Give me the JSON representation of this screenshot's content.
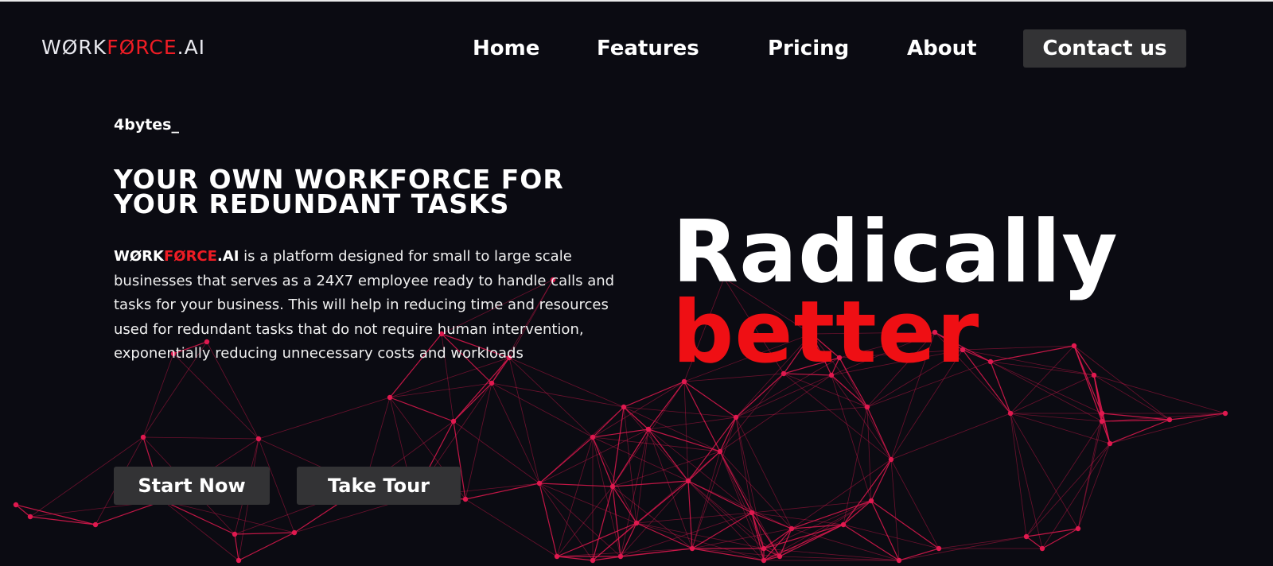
{
  "header": {
    "logo": {
      "part1": "W",
      "o1": "Ø",
      "part2": "RK",
      "red": "FØRCE",
      "suffix": ".AI"
    },
    "nav": [
      {
        "label": "Home"
      },
      {
        "label": "Features"
      },
      {
        "label": "Pricing"
      },
      {
        "label": "About"
      }
    ],
    "contact_label": "Contact us"
  },
  "hero": {
    "tagline": "4bytes_",
    "headline_line1": "YOUR OWN WORKFORCE FOR",
    "headline_line2": "YOUR REDUNDANT TASKS",
    "description": {
      "brand_light": "WØRK",
      "brand_red": "FØRCE",
      "brand_suffix": ".AI",
      "text": " is a platform designed for small to large scale businesses that serves as a 24X7 employee ready to handle calls and tasks for your business. This will help in reducing time and resources used for redundant tasks that do not require human intervention, exponentially reducing unnecessary costs and workloads"
    },
    "buttons": {
      "start": "Start Now",
      "tour": "Take Tour"
    },
    "big_line1": "Radically",
    "big_line2": "better"
  },
  "colors": {
    "background": "#0b0b12",
    "accent_red": "#ef1c24",
    "button_bg": "#333335",
    "network_line": "#e0194f"
  }
}
